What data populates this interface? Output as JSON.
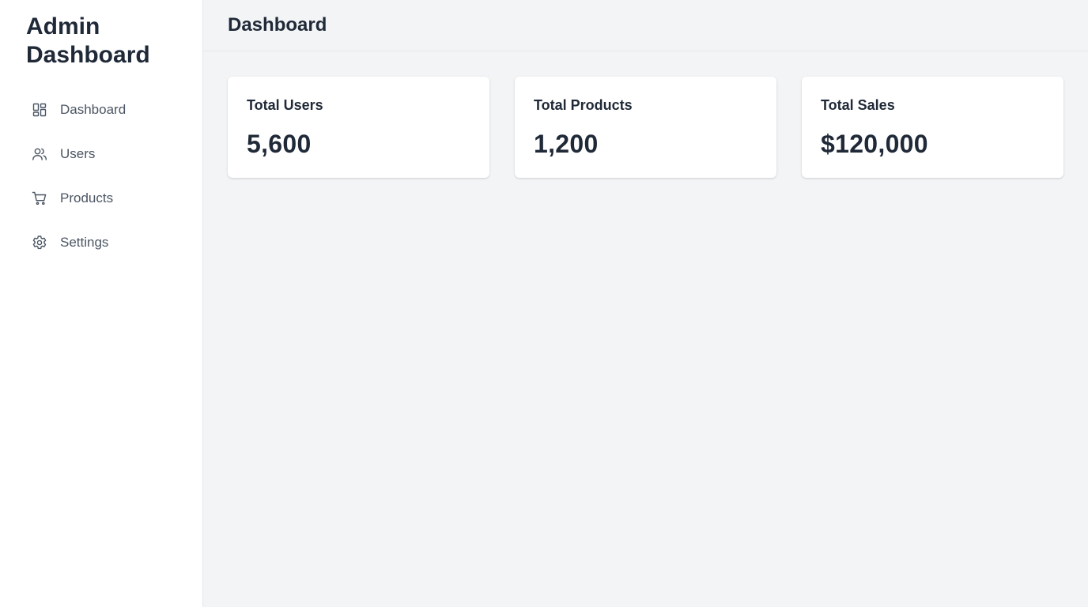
{
  "sidebar": {
    "brand_line1": "Admin",
    "brand_line2": "Dashboard",
    "items": [
      {
        "label": "Dashboard",
        "icon": "dashboard-grid-icon"
      },
      {
        "label": "Users",
        "icon": "users-icon"
      },
      {
        "label": "Products",
        "icon": "cart-icon"
      },
      {
        "label": "Settings",
        "icon": "gear-icon"
      }
    ]
  },
  "header": {
    "title": "Dashboard"
  },
  "stats": [
    {
      "label": "Total Users",
      "value": "5,600"
    },
    {
      "label": "Total Products",
      "value": "1,200"
    },
    {
      "label": "Total Sales",
      "value": "$120,000"
    }
  ],
  "colors": {
    "sidebar_bg": "#ffffff",
    "main_bg": "#f3f4f6",
    "text_dark": "#1f2937",
    "text_muted": "#4b5563",
    "border": "#e5e7eb"
  }
}
